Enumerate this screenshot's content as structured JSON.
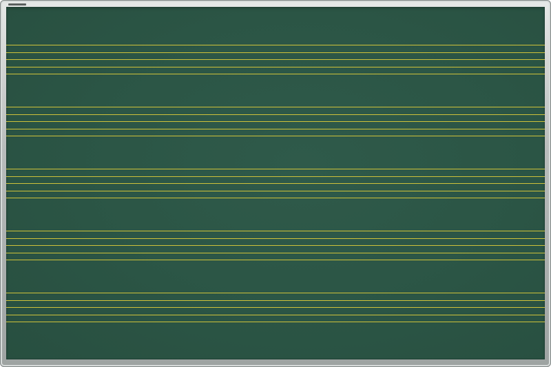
{
  "board": {
    "surface_color": "#2c5646",
    "frame_color": "#b8bcbb",
    "line_color": "#d9c93a",
    "staffs": 5,
    "lines_per_staff": 5
  }
}
